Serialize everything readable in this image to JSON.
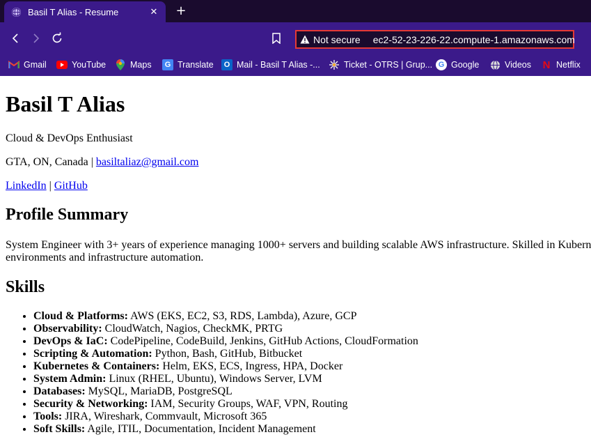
{
  "browser": {
    "tab": {
      "title": "Basil T Alias - Resume"
    },
    "address_bar": {
      "security_label": "Not secure",
      "url": "ec2-52-23-226-22.compute-1.amazonaws.com"
    },
    "bookmarks": [
      {
        "label": "Gmail",
        "icon": "gmail-icon"
      },
      {
        "label": "YouTube",
        "icon": "youtube-icon"
      },
      {
        "label": "Maps",
        "icon": "maps-icon"
      },
      {
        "label": "Translate",
        "icon": "translate-icon"
      },
      {
        "label": "Mail - Basil T Alias -...",
        "icon": "outlook-icon"
      },
      {
        "label": "Ticket - OTRS | Grup...",
        "icon": "otrs-icon"
      },
      {
        "label": "Google",
        "icon": "google-icon"
      },
      {
        "label": "Videos",
        "icon": "globe-icon"
      },
      {
        "label": "Netflix",
        "icon": "netflix-icon"
      }
    ],
    "colors": {
      "tab_bar": "#1a0b2e",
      "toolbar": "#3b1a8a",
      "alert_border": "#e53935"
    }
  },
  "resume": {
    "name": "Basil T Alias",
    "tagline": "Cloud & DevOps Enthusiast",
    "location": "GTA, ON, Canada |",
    "email": "basiltaliaz@gmail.com",
    "links": {
      "linkedin": "LinkedIn",
      "separator": "|",
      "github": "GitHub"
    },
    "summary_heading": "Profile Summary",
    "summary_lines": [
      "System Engineer with 3+ years of experience managing 1000+ servers and building scalable AWS infrastructure. Skilled in Kubern",
      "environments and infrastructure automation."
    ],
    "skills_heading": "Skills",
    "skills": [
      {
        "label": "Cloud & Platforms:",
        "value": " AWS (EKS, EC2, S3, RDS, Lambda), Azure, GCP"
      },
      {
        "label": "Observability:",
        "value": " CloudWatch, Nagios, CheckMK, PRTG"
      },
      {
        "label": "DevOps & IaC:",
        "value": " CodePipeline, CodeBuild, Jenkins, GitHub Actions, CloudFormation"
      },
      {
        "label": "Scripting & Automation:",
        "value": " Python, Bash, GitHub, Bitbucket"
      },
      {
        "label": "Kubernetes & Containers:",
        "value": " Helm, EKS, ECS, Ingress, HPA, Docker"
      },
      {
        "label": "System Admin:",
        "value": " Linux (RHEL, Ubuntu), Windows Server, LVM"
      },
      {
        "label": "Databases:",
        "value": " MySQL, MariaDB, PostgreSQL"
      },
      {
        "label": "Security & Networking:",
        "value": " IAM, Security Groups, WAF, VPN, Routing"
      },
      {
        "label": "Tools:",
        "value": " JIRA, Wireshark, Commvault, Microsoft 365"
      },
      {
        "label": "Soft Skills:",
        "value": " Agile, ITIL, Documentation, Incident Management"
      }
    ]
  }
}
